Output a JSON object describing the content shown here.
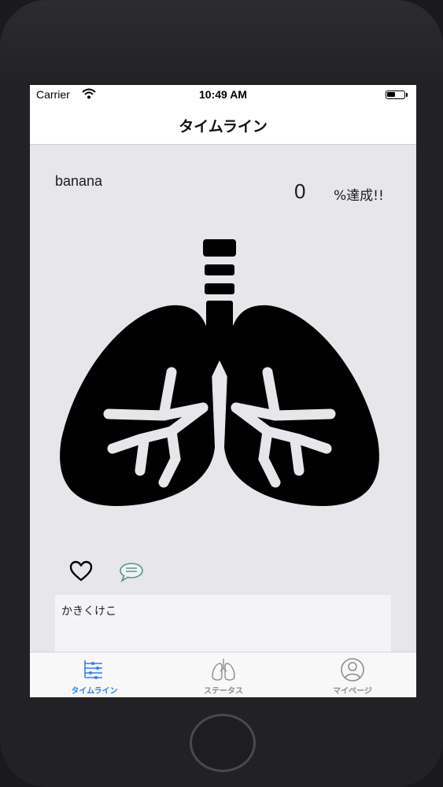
{
  "status_bar": {
    "carrier": "Carrier",
    "time": "10:49 AM"
  },
  "nav": {
    "title": "タイムライン"
  },
  "post": {
    "username": "banana",
    "progress_value": "0",
    "progress_suffix": "%達成!!",
    "image_icon": "lungs-icon",
    "comment": "かきくけこ"
  },
  "actions": {
    "like_icon": "heart-icon",
    "comment_icon": "chat-bubble-icon"
  },
  "tab_bar": {
    "tabs": [
      {
        "label": "タイムライン",
        "icon": "timeline-icon",
        "selected": true
      },
      {
        "label": "ステータス",
        "icon": "lungs-icon",
        "selected": false
      },
      {
        "label": "マイページ",
        "icon": "person-circle-icon",
        "selected": false
      }
    ]
  },
  "colors": {
    "accent": "#2f80ed",
    "inactive": "#8e8e93",
    "screen_bg": "#e6e6eb"
  }
}
